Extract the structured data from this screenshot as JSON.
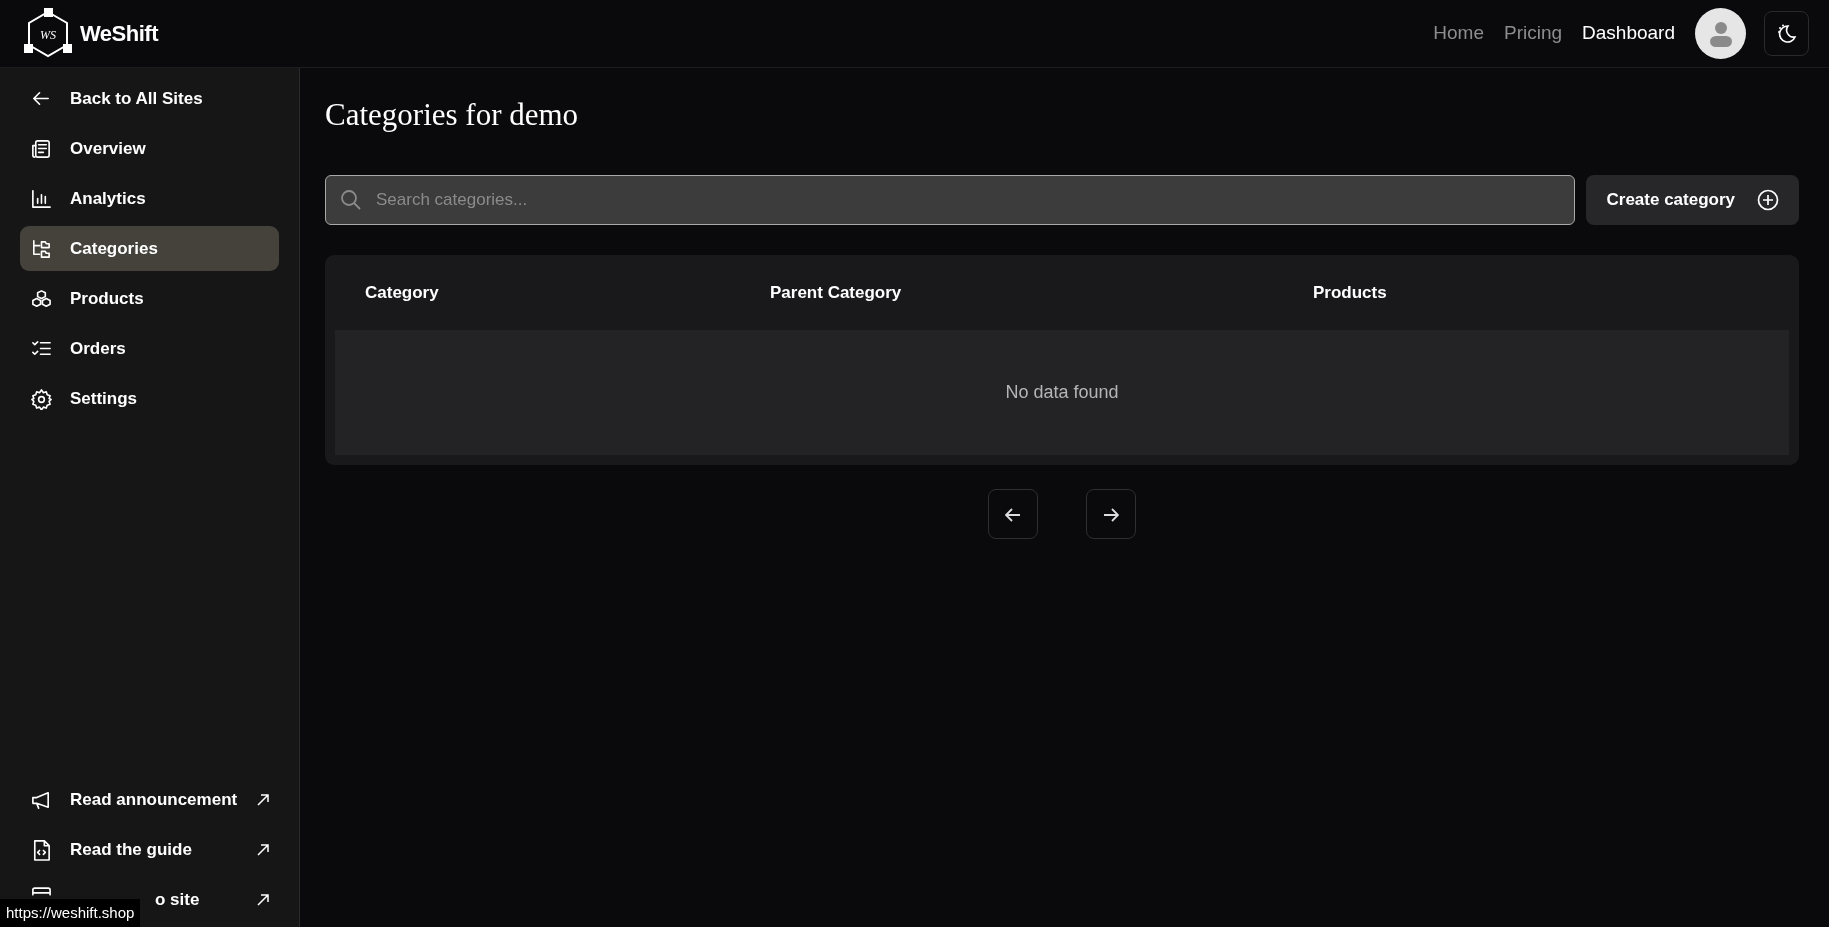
{
  "brand": {
    "name": "WeShift",
    "monogram": "WS"
  },
  "top_nav": [
    {
      "label": "Home",
      "selected": false
    },
    {
      "label": "Pricing",
      "selected": false
    },
    {
      "label": "Dashboard",
      "selected": true
    }
  ],
  "sidebar": {
    "back": {
      "label": "Back to All Sites"
    },
    "items": [
      {
        "label": "Overview",
        "kind": "overview",
        "selected": false
      },
      {
        "label": "Analytics",
        "kind": "analytics",
        "selected": false
      },
      {
        "label": "Categories",
        "kind": "categories",
        "selected": true
      },
      {
        "label": "Products",
        "kind": "products",
        "selected": false
      },
      {
        "label": "Orders",
        "kind": "orders",
        "selected": false
      },
      {
        "label": "Settings",
        "kind": "settings",
        "selected": false
      }
    ],
    "links": [
      {
        "label": "Read announcement",
        "kind": "announcement"
      },
      {
        "label": "Read the guide",
        "kind": "guide"
      },
      {
        "label": "o site",
        "kind": "site"
      }
    ]
  },
  "page": {
    "title": "Categories for demo",
    "search": {
      "placeholder": "Search categories..."
    },
    "create_button": "Create category"
  },
  "table": {
    "columns": [
      "Category",
      "Parent Category",
      "Products"
    ],
    "empty_message": "No data found"
  },
  "status_url": "https://weshift.shop"
}
